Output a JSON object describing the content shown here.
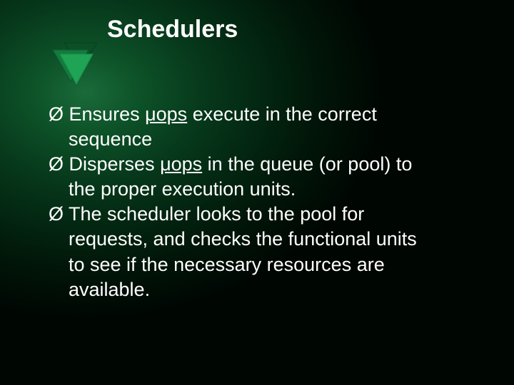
{
  "title": "Schedulers",
  "bullets": [
    {
      "marker": "Ø",
      "lead": "Ensures ",
      "uword": "μops",
      "rest": " execute in the correct",
      "cont": [
        "sequence"
      ]
    },
    {
      "marker": "Ø",
      "lead": "Disperses ",
      "uword": "μops",
      "rest": " in the queue (or pool) to",
      "cont": [
        "the proper execution units."
      ]
    },
    {
      "marker": "Ø",
      "lead": "The scheduler looks to the pool for",
      "uword": "",
      "rest": "",
      "cont": [
        "requests, and checks the functional units",
        "to see if the necessary resources are",
        "available."
      ]
    }
  ]
}
